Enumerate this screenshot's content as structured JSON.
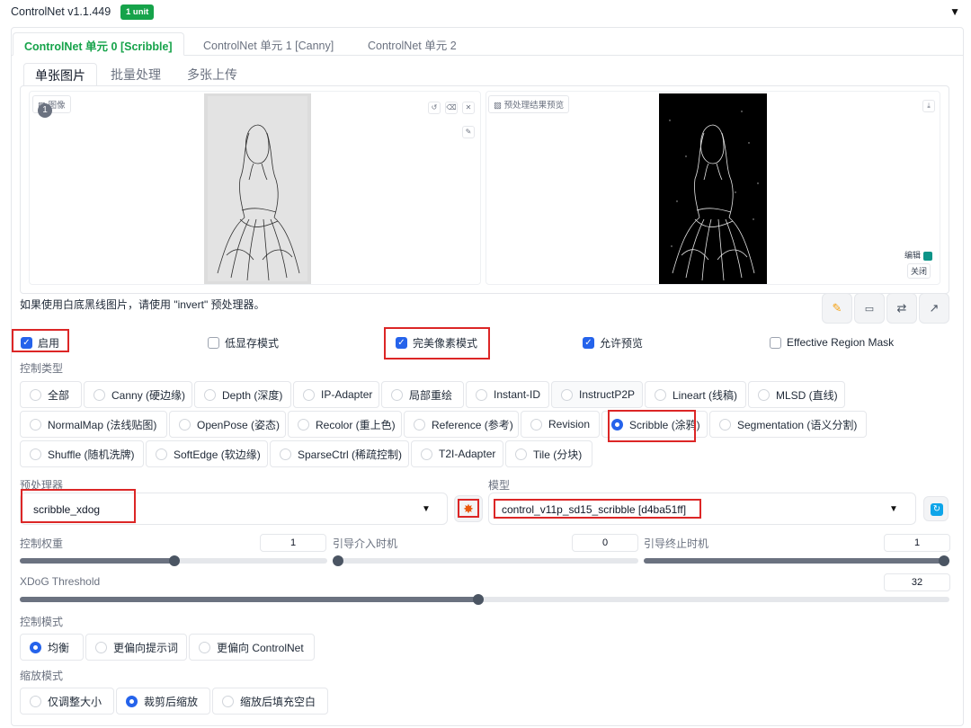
{
  "header": {
    "title": "ControlNet v1.1.449",
    "badge": "1 unit",
    "collapse_icon": "triangle-down-icon"
  },
  "unit_tabs": [
    {
      "label": "ControlNet 单元 0 [Scribble]",
      "active": true
    },
    {
      "label": "ControlNet 单元 1 [Canny]",
      "active": false
    },
    {
      "label": "ControlNet 单元 2",
      "active": false
    }
  ],
  "mode_tabs": [
    {
      "label": "单张图片",
      "active": true
    },
    {
      "label": "批量处理",
      "active": false
    },
    {
      "label": "多张上传",
      "active": false
    }
  ],
  "input_image": {
    "label": "图像",
    "step_badge": "1",
    "tool_icons": [
      "rotate-icon",
      "eraser-icon",
      "close-icon",
      "brush-icon"
    ]
  },
  "preview_image": {
    "label": "预处理结果预览",
    "download_icon": "download-icon",
    "edit_label": "编辑",
    "close_label": "关闭"
  },
  "hint": "如果使用白底黑线图片，请使用 \"invert\" 预处理器。",
  "tools": [
    "pencil-icon",
    "camera-icon",
    "swap-icon",
    "arrow-up-right-icon"
  ],
  "options": {
    "enable": {
      "label": "启用",
      "checked": true
    },
    "low_vram": {
      "label": "低显存模式",
      "checked": false
    },
    "pixel_perfect": {
      "label": "完美像素模式",
      "checked": true
    },
    "allow_preview": {
      "label": "允许预览",
      "checked": true
    },
    "region_mask": {
      "label": "Effective Region Mask",
      "checked": false
    }
  },
  "control_type": {
    "label": "控制类型",
    "selected": "Scribble (涂鸦)",
    "items": [
      "全部",
      "Canny (硬边缘)",
      "Depth (深度)",
      "IP-Adapter",
      "局部重绘",
      "Instant-ID",
      "InstructP2P",
      "Lineart (线稿)",
      "MLSD (直线)",
      "NormalMap (法线贴图)",
      "OpenPose (姿态)",
      "Recolor (重上色)",
      "Reference (参考)",
      "Revision",
      "Scribble (涂鸦)",
      "Segmentation (语义分割)",
      "Shuffle (随机洗牌)",
      "SoftEdge (软边缘)",
      "SparseCtrl (稀疏控制)",
      "T2I-Adapter",
      "Tile (分块)"
    ]
  },
  "preprocessor": {
    "label": "预处理器",
    "value": "scribble_xdog",
    "run_icon": "explosion-icon"
  },
  "model": {
    "label": "模型",
    "value": "control_v11p_sd15_scribble [d4ba51ff]",
    "refresh_icon": "refresh-icon"
  },
  "sliders": {
    "weight": {
      "label": "控制权重",
      "value": "1",
      "fraction": 0.5
    },
    "start": {
      "label": "引导介入时机",
      "value": "0",
      "fraction": 0.0
    },
    "end": {
      "label": "引导终止时机",
      "value": "1",
      "fraction": 1.0
    },
    "xdog": {
      "label": "XDoG Threshold",
      "value": "32",
      "fraction": 0.49
    }
  },
  "control_mode": {
    "label": "控制模式",
    "items": [
      "均衡",
      "更偏向提示词",
      "更偏向 ControlNet"
    ],
    "selected": "均衡"
  },
  "resize_mode": {
    "label": "缩放模式",
    "items": [
      "仅调整大小",
      "裁剪后缩放",
      "缩放后填充空白"
    ],
    "selected": "裁剪后缩放"
  },
  "colors": {
    "accent": "#2563eb",
    "active_tab": "#16a34a",
    "highlight": "#dc2626"
  }
}
